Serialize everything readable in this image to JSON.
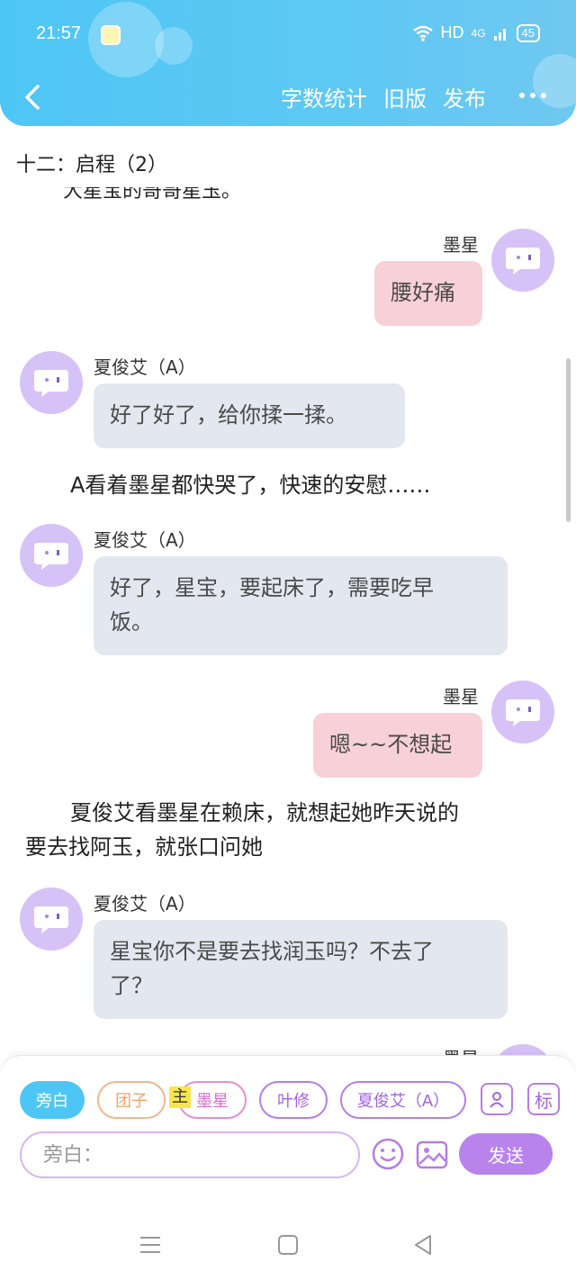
{
  "status_bar": {
    "time": "21:57",
    "network": "HD",
    "signal": "4G",
    "battery": "45"
  },
  "header": {
    "back_icon": "chevron-left-icon",
    "actions": [
      "字数统计",
      "旧版",
      "发布"
    ],
    "more_icon": "more-dots-icon"
  },
  "chapter_title": "十二：启程（2）",
  "cut_text": "大星宝的哥哥星玉。",
  "messages": [
    {
      "speaker": "墨星",
      "side": "right",
      "text": "腰好痛"
    },
    {
      "speaker": "夏俊艾（A）",
      "side": "left",
      "text": "好了好了，给你揉一揉。"
    },
    {
      "narration": "A看着墨星都快哭了，快速的安慰……"
    },
    {
      "speaker": "夏俊艾（A）",
      "side": "left",
      "text": "好了，星宝，要起床了，需要吃早饭。"
    },
    {
      "speaker": "墨星",
      "side": "right",
      "text": "嗯~~不想起"
    },
    {
      "narration": "夏俊艾看墨星在赖床，就想起她昨天说的要去找阿玉，就张口问她"
    },
    {
      "speaker": "夏俊艾（A）",
      "side": "left",
      "text": "星宝你不是要去找润玉吗？不去了？"
    },
    {
      "speaker": "墨星",
      "side": "right",
      "text": ""
    }
  ],
  "msg_lines": {
    "m3a": "好了，星宝，要起床了，需要吃早",
    "m3b": "饭。",
    "n2a": "夏俊艾看墨星在赖床，就想起她昨天说的",
    "n2b": "要去找阿玉，就张口问她",
    "m5a": "星宝你不是要去找润玉吗？不去了",
    "m5b": "了？"
  },
  "composer": {
    "roles": [
      "旁白",
      "团子",
      "墨星",
      "叶修",
      "夏俊艾（A）"
    ],
    "active_role": "旁白",
    "main_tag": "主",
    "role_icon": "person-card-icon",
    "mark_label": "标",
    "input_placeholder": "旁白：",
    "emoji_icon": "emoji-icon",
    "image_icon": "image-icon",
    "send_label": "发送"
  },
  "system_nav": [
    "menu-icon",
    "home-icon",
    "back-triangle-icon"
  ]
}
